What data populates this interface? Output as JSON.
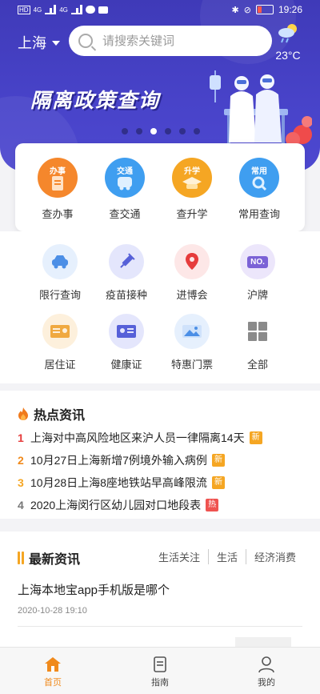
{
  "status_bar": {
    "left_indicators": [
      "HD",
      "4G",
      "4G"
    ],
    "time": "19:26"
  },
  "header": {
    "city": "上海",
    "search_placeholder": "请搜索关键词",
    "weather": {
      "icon": "cloud-rain-icon",
      "temp": "23°C"
    }
  },
  "banner": {
    "title": "隔离政策查询",
    "dots": 6,
    "active_dot": 2
  },
  "top_services": [
    {
      "tag": "办事",
      "label": "查办事",
      "color": "#f5872c",
      "icon": "document-icon"
    },
    {
      "tag": "交通",
      "label": "查交通",
      "color": "#3f9ef0",
      "icon": "bus-icon"
    },
    {
      "tag": "升学",
      "label": "查升学",
      "color": "#f5a623",
      "icon": "graduation-icon"
    },
    {
      "tag": "常用",
      "label": "常用查询",
      "color": "#3f9ef0",
      "icon": "search-icon"
    }
  ],
  "services": [
    {
      "label": "限行查询",
      "icon": "car-icon",
      "bg": "#e6f0fd",
      "color": "#4c8fe6"
    },
    {
      "label": "疫苗接种",
      "icon": "syringe-icon",
      "bg": "#e4e6fc",
      "color": "#5660d8"
    },
    {
      "label": "进博会",
      "icon": "location-pin-icon",
      "bg": "#fde7e7",
      "color": "#e63c3c"
    },
    {
      "label": "沪牌",
      "icon": "plate-icon",
      "bg": "#ece6fb",
      "color": "#7b62d6",
      "text": "NO."
    },
    {
      "label": "居住证",
      "icon": "id-card-icon",
      "bg": "#fdf0dc",
      "color": "#f0a940"
    },
    {
      "label": "健康证",
      "icon": "health-card-icon",
      "bg": "#e4e6fc",
      "color": "#5660d8"
    },
    {
      "label": "特惠门票",
      "icon": "landscape-ticket-icon",
      "bg": "#e6f0fd",
      "color": "#4c8fe6"
    },
    {
      "label": "全部",
      "icon": "grid-icon",
      "bg": "#ffffff",
      "color": "#8a8a8a"
    }
  ],
  "hot_news": {
    "title": "热点资讯",
    "items": [
      {
        "num": "1",
        "text": "上海对中高风险地区来沪人员一律隔离14天",
        "badge": "新",
        "num_color": "#e63c3c",
        "badge_color": "#f5a623"
      },
      {
        "num": "2",
        "text": "10月27日上海新增7例境外输入病例",
        "badge": "新",
        "num_color": "#f08a1c",
        "badge_color": "#f5a623"
      },
      {
        "num": "3",
        "text": "10月28日上海8座地铁站早高峰限流",
        "badge": "新",
        "num_color": "#f5a623",
        "badge_color": "#f5a623"
      },
      {
        "num": "4",
        "text": "2020上海闵行区幼儿园对口地段表",
        "badge": "热",
        "num_color": "#777777",
        "badge_color": "#ef5350"
      }
    ]
  },
  "latest_news": {
    "title": "最新资讯",
    "tabs": [
      "生活关注",
      "生活",
      "经济消费"
    ],
    "article": {
      "title": "上海本地宝app手机版是哪个",
      "date": "2020-10-28 19:10"
    }
  },
  "bottom_nav": [
    {
      "label": "首页",
      "icon": "home-icon",
      "active": true
    },
    {
      "label": "指南",
      "icon": "guide-document-icon",
      "active": false
    },
    {
      "label": "我的",
      "icon": "user-icon",
      "active": false
    }
  ]
}
